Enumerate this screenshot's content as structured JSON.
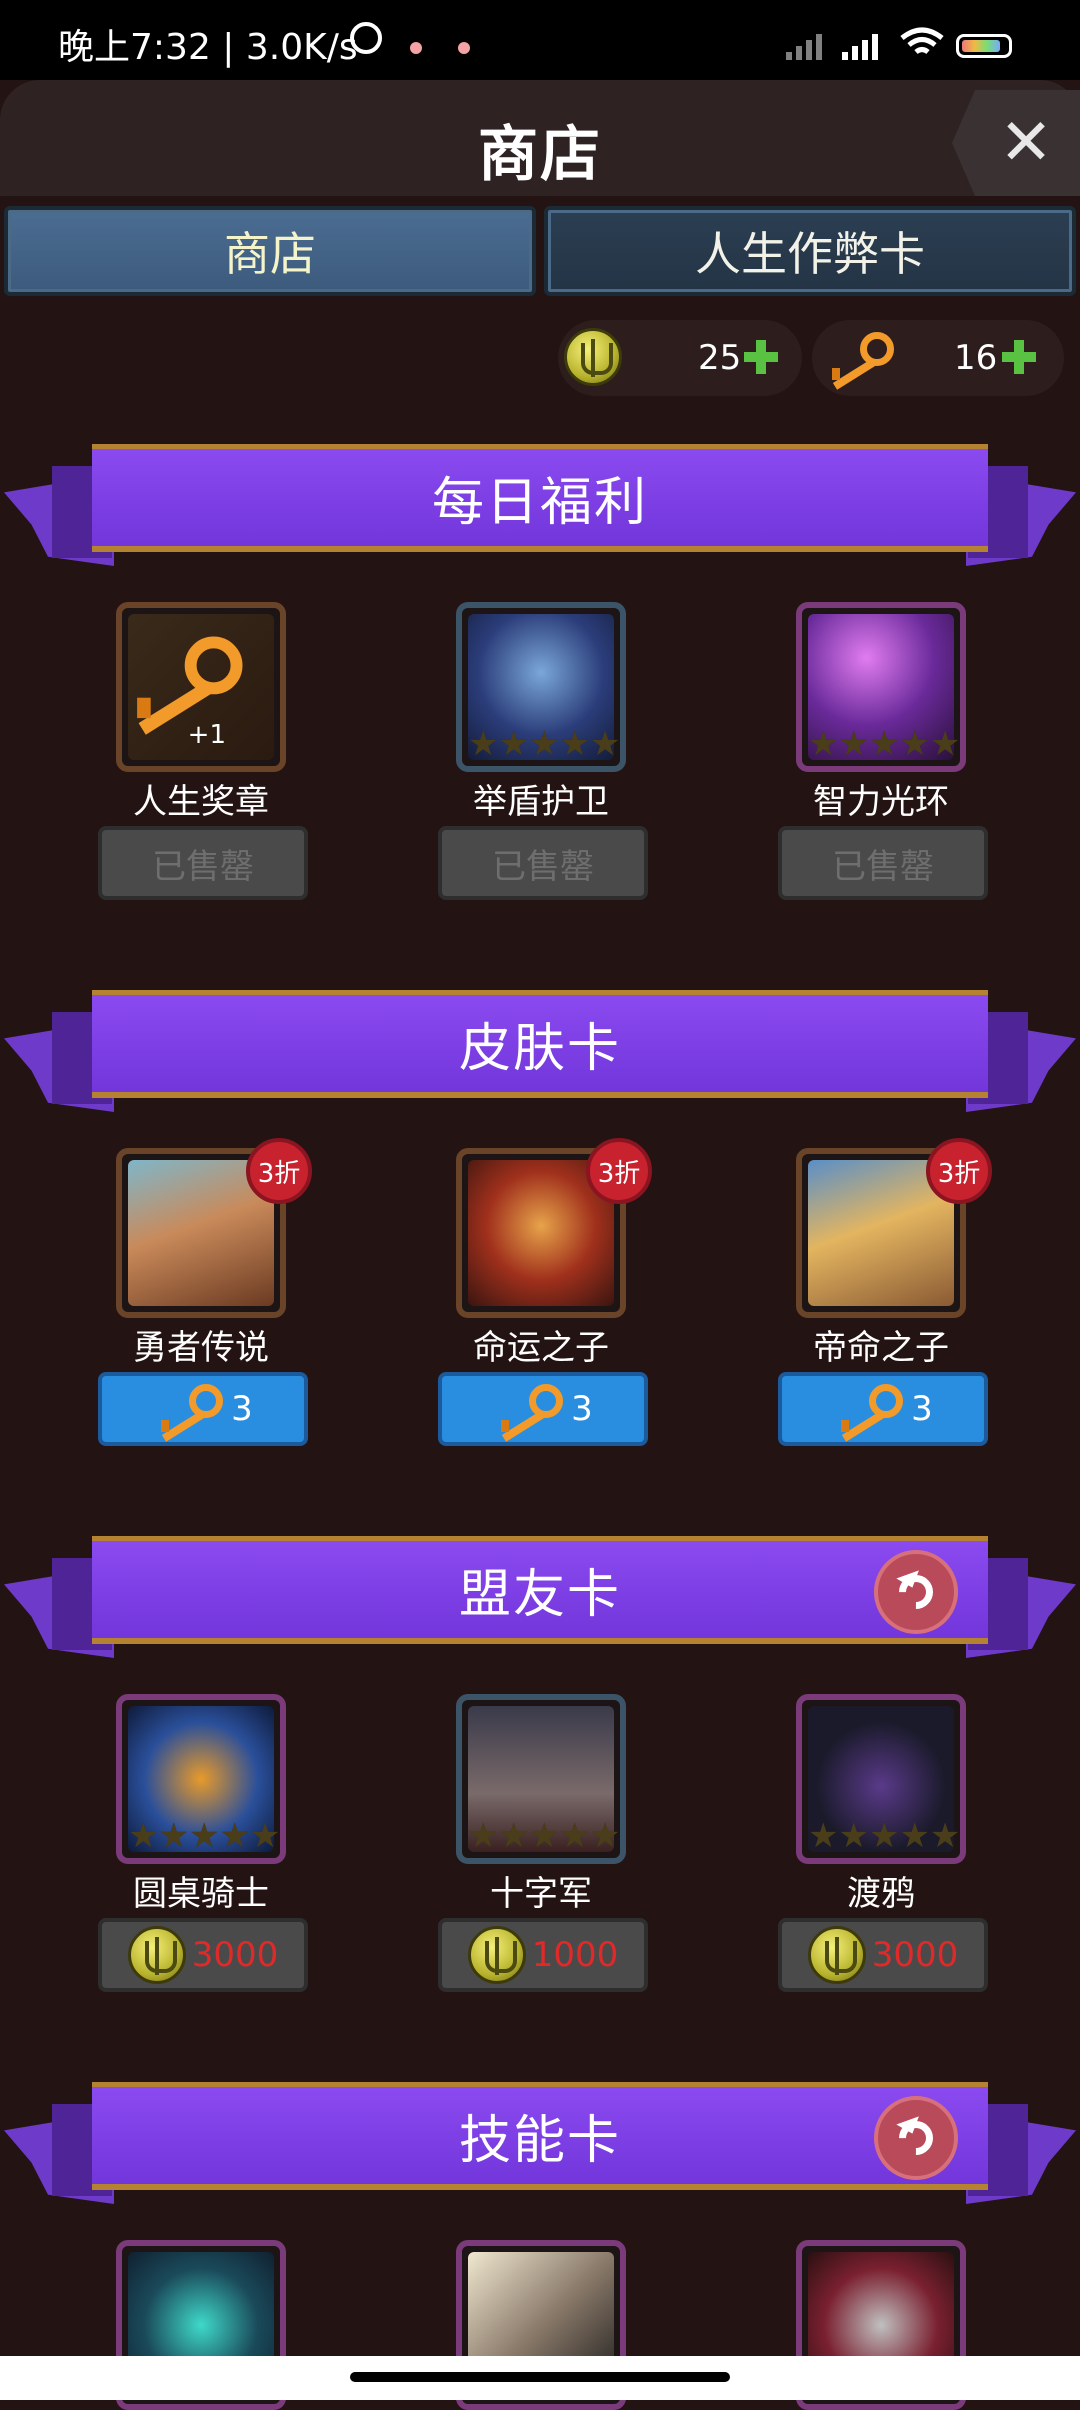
{
  "status": {
    "time": "晚上7:32 | 3.0K/s",
    "battery": "98"
  },
  "header": {
    "title": "商店",
    "close": "✕"
  },
  "tabs": [
    {
      "label": "商店"
    },
    {
      "label": "人生作弊卡"
    }
  ],
  "currencies": {
    "coins": "25",
    "keys": "16"
  },
  "sections": [
    {
      "title": "每日福利",
      "items": [
        {
          "name": "人生奖章",
          "qty": "+1",
          "button": "已售罄"
        },
        {
          "name": "举盾护卫",
          "button": "已售罄"
        },
        {
          "name": "智力光环",
          "button": "已售罄"
        }
      ]
    },
    {
      "title": "皮肤卡",
      "items": [
        {
          "name": "勇者传说",
          "badge": "3折",
          "price": "3"
        },
        {
          "name": "命运之子",
          "badge": "3折",
          "price": "3"
        },
        {
          "name": "帝命之子",
          "badge": "3折",
          "price": "3"
        }
      ]
    },
    {
      "title": "盟友卡",
      "items": [
        {
          "name": "圆桌骑士",
          "price": "3000"
        },
        {
          "name": "十字军",
          "price": "1000"
        },
        {
          "name": "渡鸦",
          "price": "3000"
        }
      ]
    },
    {
      "title": "技能卡",
      "items": [
        {},
        {},
        {}
      ]
    }
  ],
  "stars": "★★★★★"
}
